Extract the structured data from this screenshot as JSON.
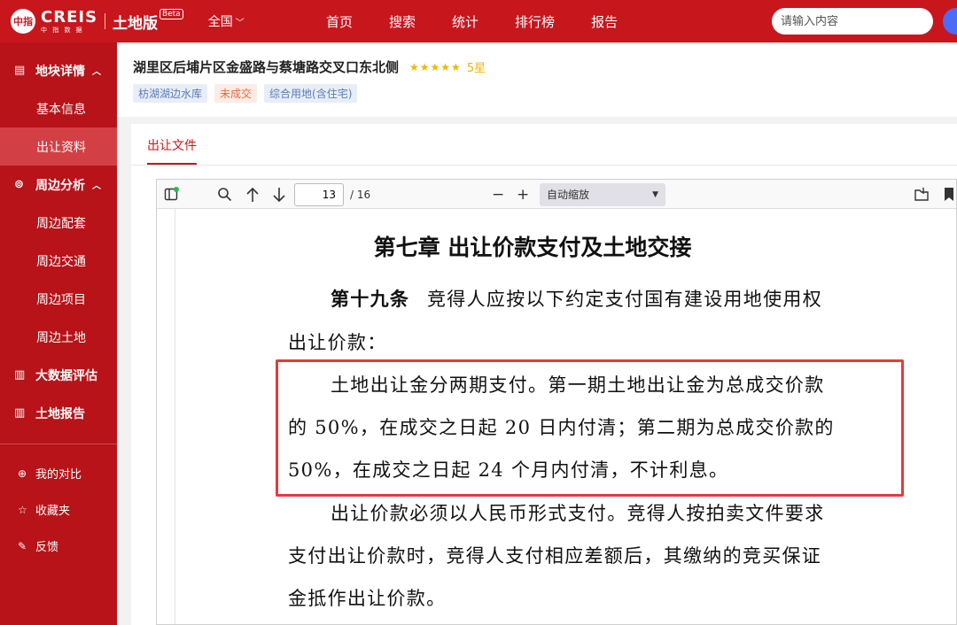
{
  "header": {
    "logo_mark": "中指",
    "logo_name": "CREIS",
    "logo_sub": "中 指 数 据",
    "product": "土地版",
    "beta": "Beta",
    "region": "全国",
    "nav": [
      "首页",
      "搜索",
      "统计",
      "排行榜",
      "报告"
    ],
    "search_placeholder": "请输入内容"
  },
  "sidebar": {
    "sections": [
      {
        "label": "地块详情",
        "icon": "document-icon",
        "items": [
          "基本信息",
          "出让资料"
        ]
      },
      {
        "label": "周边分析",
        "icon": "location-icon",
        "items": [
          "周边配套",
          "周边交通",
          "周边项目",
          "周边土地"
        ]
      },
      {
        "label": "大数据评估",
        "icon": "building-icon",
        "items": []
      },
      {
        "label": "土地报告",
        "icon": "building-icon",
        "items": []
      }
    ],
    "active_item": "出让资料",
    "extras": [
      {
        "label": "我的对比",
        "icon": "plus-circle-icon"
      },
      {
        "label": "收藏夹",
        "icon": "star-icon"
      },
      {
        "label": "反馈",
        "icon": "pencil-icon"
      }
    ]
  },
  "parcel": {
    "title": "湖里区后埔片区金盛路与蔡塘路交叉口东北侧",
    "rating_stars": 5,
    "rating_label": "5星",
    "tags": [
      "枋湖湖边水库",
      "未成交",
      "综合用地(含住宅)"
    ]
  },
  "tabs": {
    "active": "出让文件"
  },
  "viewer": {
    "current_page": "13",
    "total_pages": "/ 16",
    "zoom": "自动缩放"
  },
  "document": {
    "heading": "第七章  出让价款支付及土地交接",
    "article_label": "第十九条",
    "lines": [
      "竞得人应按以下约定支付国有建设用地使用权",
      "出让价款：",
      "土地出让金分两期支付。第一期土地出让金为总成交价款",
      "的 50%，在成交之日起 20 日内付清；第二期为总成交价款的",
      "50%，在成交之日起 24 个月内付清，不计利息。",
      "出让价款必须以人民币形式支付。竞得人按拍卖文件要求",
      "支付出让价款时，竞得人支付相应差额后，其缴纳的竞买保证",
      "金抵作出让价款。"
    ]
  }
}
